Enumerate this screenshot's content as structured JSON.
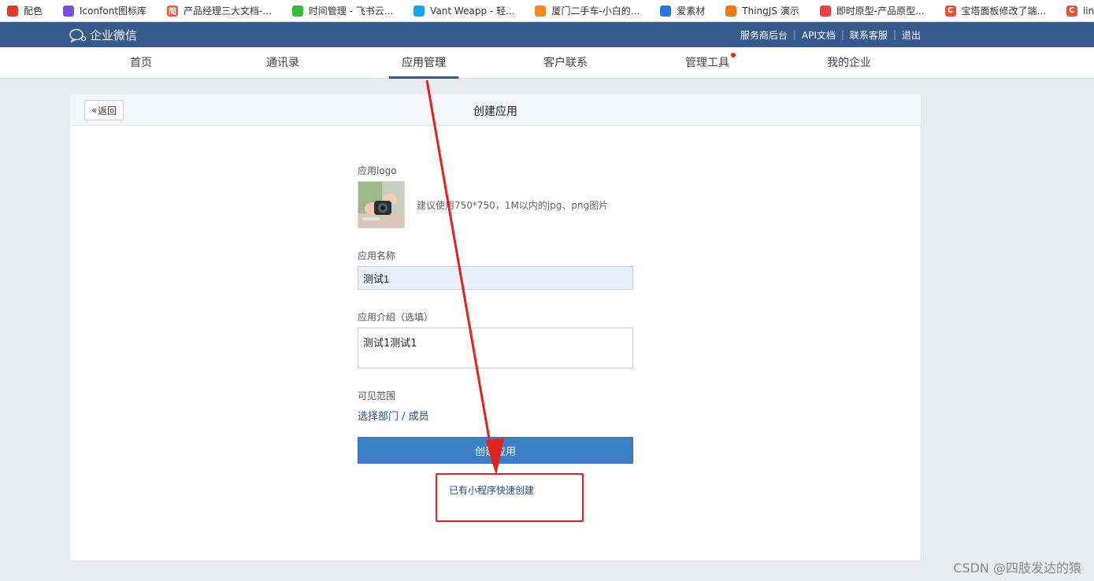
{
  "bookmarks": [
    {
      "label": "配色",
      "color": "#e43a2d",
      "glyph": "",
      "icon": "palette-icon"
    },
    {
      "label": "Iconfont图标库",
      "color": "#7b4dd6",
      "glyph": "",
      "icon": "iconfont-icon"
    },
    {
      "label": "产品经理三大文档-...",
      "color": "#e85c3e",
      "glyph": "简",
      "icon": "jianshu-icon"
    },
    {
      "label": "时间管理 - 飞书云...",
      "color": "#3cb83c",
      "glyph": "",
      "icon": "feishu-doc-icon"
    },
    {
      "label": "Vant Weapp - 轻...",
      "color": "#1aa4e8",
      "glyph": "",
      "icon": "vant-icon"
    },
    {
      "label": "厦门二手车-小白的...",
      "color": "#f08a24",
      "glyph": "",
      "icon": "car-site-icon"
    },
    {
      "label": "爱素材",
      "color": "#2a74d8",
      "glyph": "",
      "icon": "aisucai-icon"
    },
    {
      "label": "ThingJS 演示",
      "color": "#f07a1a",
      "glyph": "",
      "icon": "thingjs-icon"
    },
    {
      "label": "即时原型-产品原型...",
      "color": "#e5404c",
      "glyph": "",
      "icon": "jishi-icon"
    },
    {
      "label": "宝塔面板修改了端...",
      "color": "#e8533b",
      "glyph": "C",
      "icon": "csdn-icon"
    },
    {
      "label": "linux（cer",
      "color": "#e8533b",
      "glyph": "C",
      "icon": "csdn-icon"
    }
  ],
  "header": {
    "logo_text": "企业微信",
    "links": [
      "服务商后台",
      "API文档",
      "联系客服",
      "退出"
    ]
  },
  "nav": {
    "items": [
      "首页",
      "通讯录",
      "应用管理",
      "客户联系",
      "管理工具",
      "我的企业"
    ],
    "active": "应用管理"
  },
  "card": {
    "back_label": "返回",
    "title": "创建应用"
  },
  "form": {
    "logo_label": "应用logo",
    "logo_hint": "建议使用750*750，1M以内的jpg、png图片",
    "name_label": "应用名称",
    "name_value": "测试1",
    "desc_label": "应用介绍（选填）",
    "desc_value": "测试1测试1",
    "scope_label": "可见范围",
    "scope_link": "选择部门 / 成员",
    "submit_label": "创建应用",
    "quick_create_link": "已有小程序快速创建"
  },
  "annotation": {
    "color": "#e5211d"
  },
  "watermark": "CSDN @四肢发达的猿"
}
